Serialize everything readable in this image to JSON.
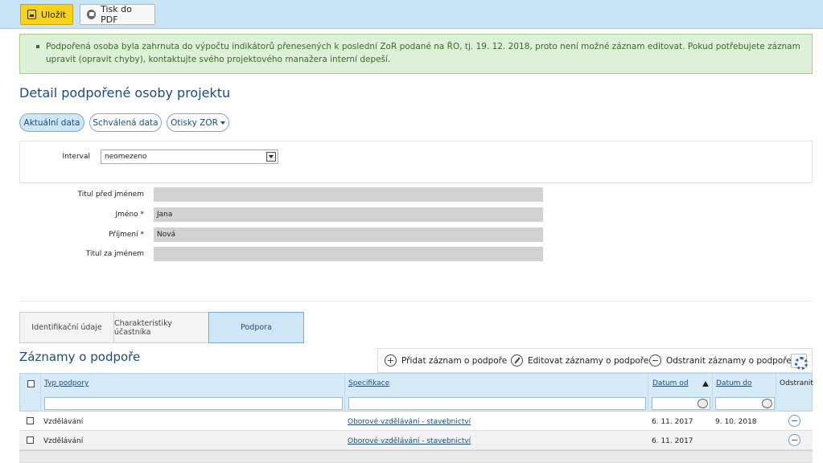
{
  "toolbar": {
    "save_label": "Uložit",
    "pdf_label": "Tisk do PDF"
  },
  "alert": {
    "text": "Podpořená osoba byla zahrnuta do výpočtu indikátorů přenesených k poslední ZoR podané na ŘO, tj. 19. 12. 2018, proto není možné záznam editovat. Pokud potřebujete záznam upravit (opravit chyby), kontaktujte svého projektového manažera interní depeší."
  },
  "page": {
    "title": "Detail podpořené osoby projektu"
  },
  "view_tabs": {
    "current": "Aktuální data",
    "approved": "Schválená data",
    "snapshots": "Otisky ZOR"
  },
  "interval": {
    "label": "Interval",
    "value": "neomezeno"
  },
  "person": {
    "title_before_label": "Titul před jménem",
    "title_before_value": "",
    "first_name_label": "Jméno *",
    "first_name_value": "Jana",
    "last_name_label": "Příjmení *",
    "last_name_value": "Nová",
    "title_after_label": "Titul za jménem",
    "title_after_value": ""
  },
  "section_tabs": {
    "identification": "Identifikační údaje",
    "characteristics": "Charakteristiky účastníka",
    "support": "Podpora"
  },
  "records": {
    "title": "Záznamy o podpoře",
    "add_label": "Přidat záznam o podpoře",
    "edit_label": "Editovat záznamy o podpoře",
    "remove_label": "Odstranit záznamy o podpoře",
    "columns": {
      "type": "Typ podpory",
      "spec": "Specifikace",
      "date_from": "Datum od",
      "date_to": "Datum do",
      "remove": "Odstranit"
    },
    "rows": [
      {
        "type": "Vzdělávání",
        "spec": "Oborové vzdělávání - stavebnictví",
        "date_from": "6. 11. 2017",
        "date_to": "9. 10. 2018"
      },
      {
        "type": "Vzdělávání",
        "spec": "Oborové vzdělávání - stavebnictví",
        "date_from": "6. 11. 2017",
        "date_to": ""
      }
    ]
  },
  "icons": {
    "save": "save-icon",
    "print": "printer-icon",
    "add": "plus-circle-icon",
    "edit": "pencil-icon",
    "remove": "minus-circle-icon",
    "settings": "gear-icon",
    "calendar": "calendar-icon",
    "sort": "sort-ascending-icon"
  },
  "colors": {
    "accent": "#1e4b7a",
    "save_button": "#f7d21f",
    "toolbar_bg": "#c9e4f6",
    "alert_bg": "#dff0d8"
  }
}
